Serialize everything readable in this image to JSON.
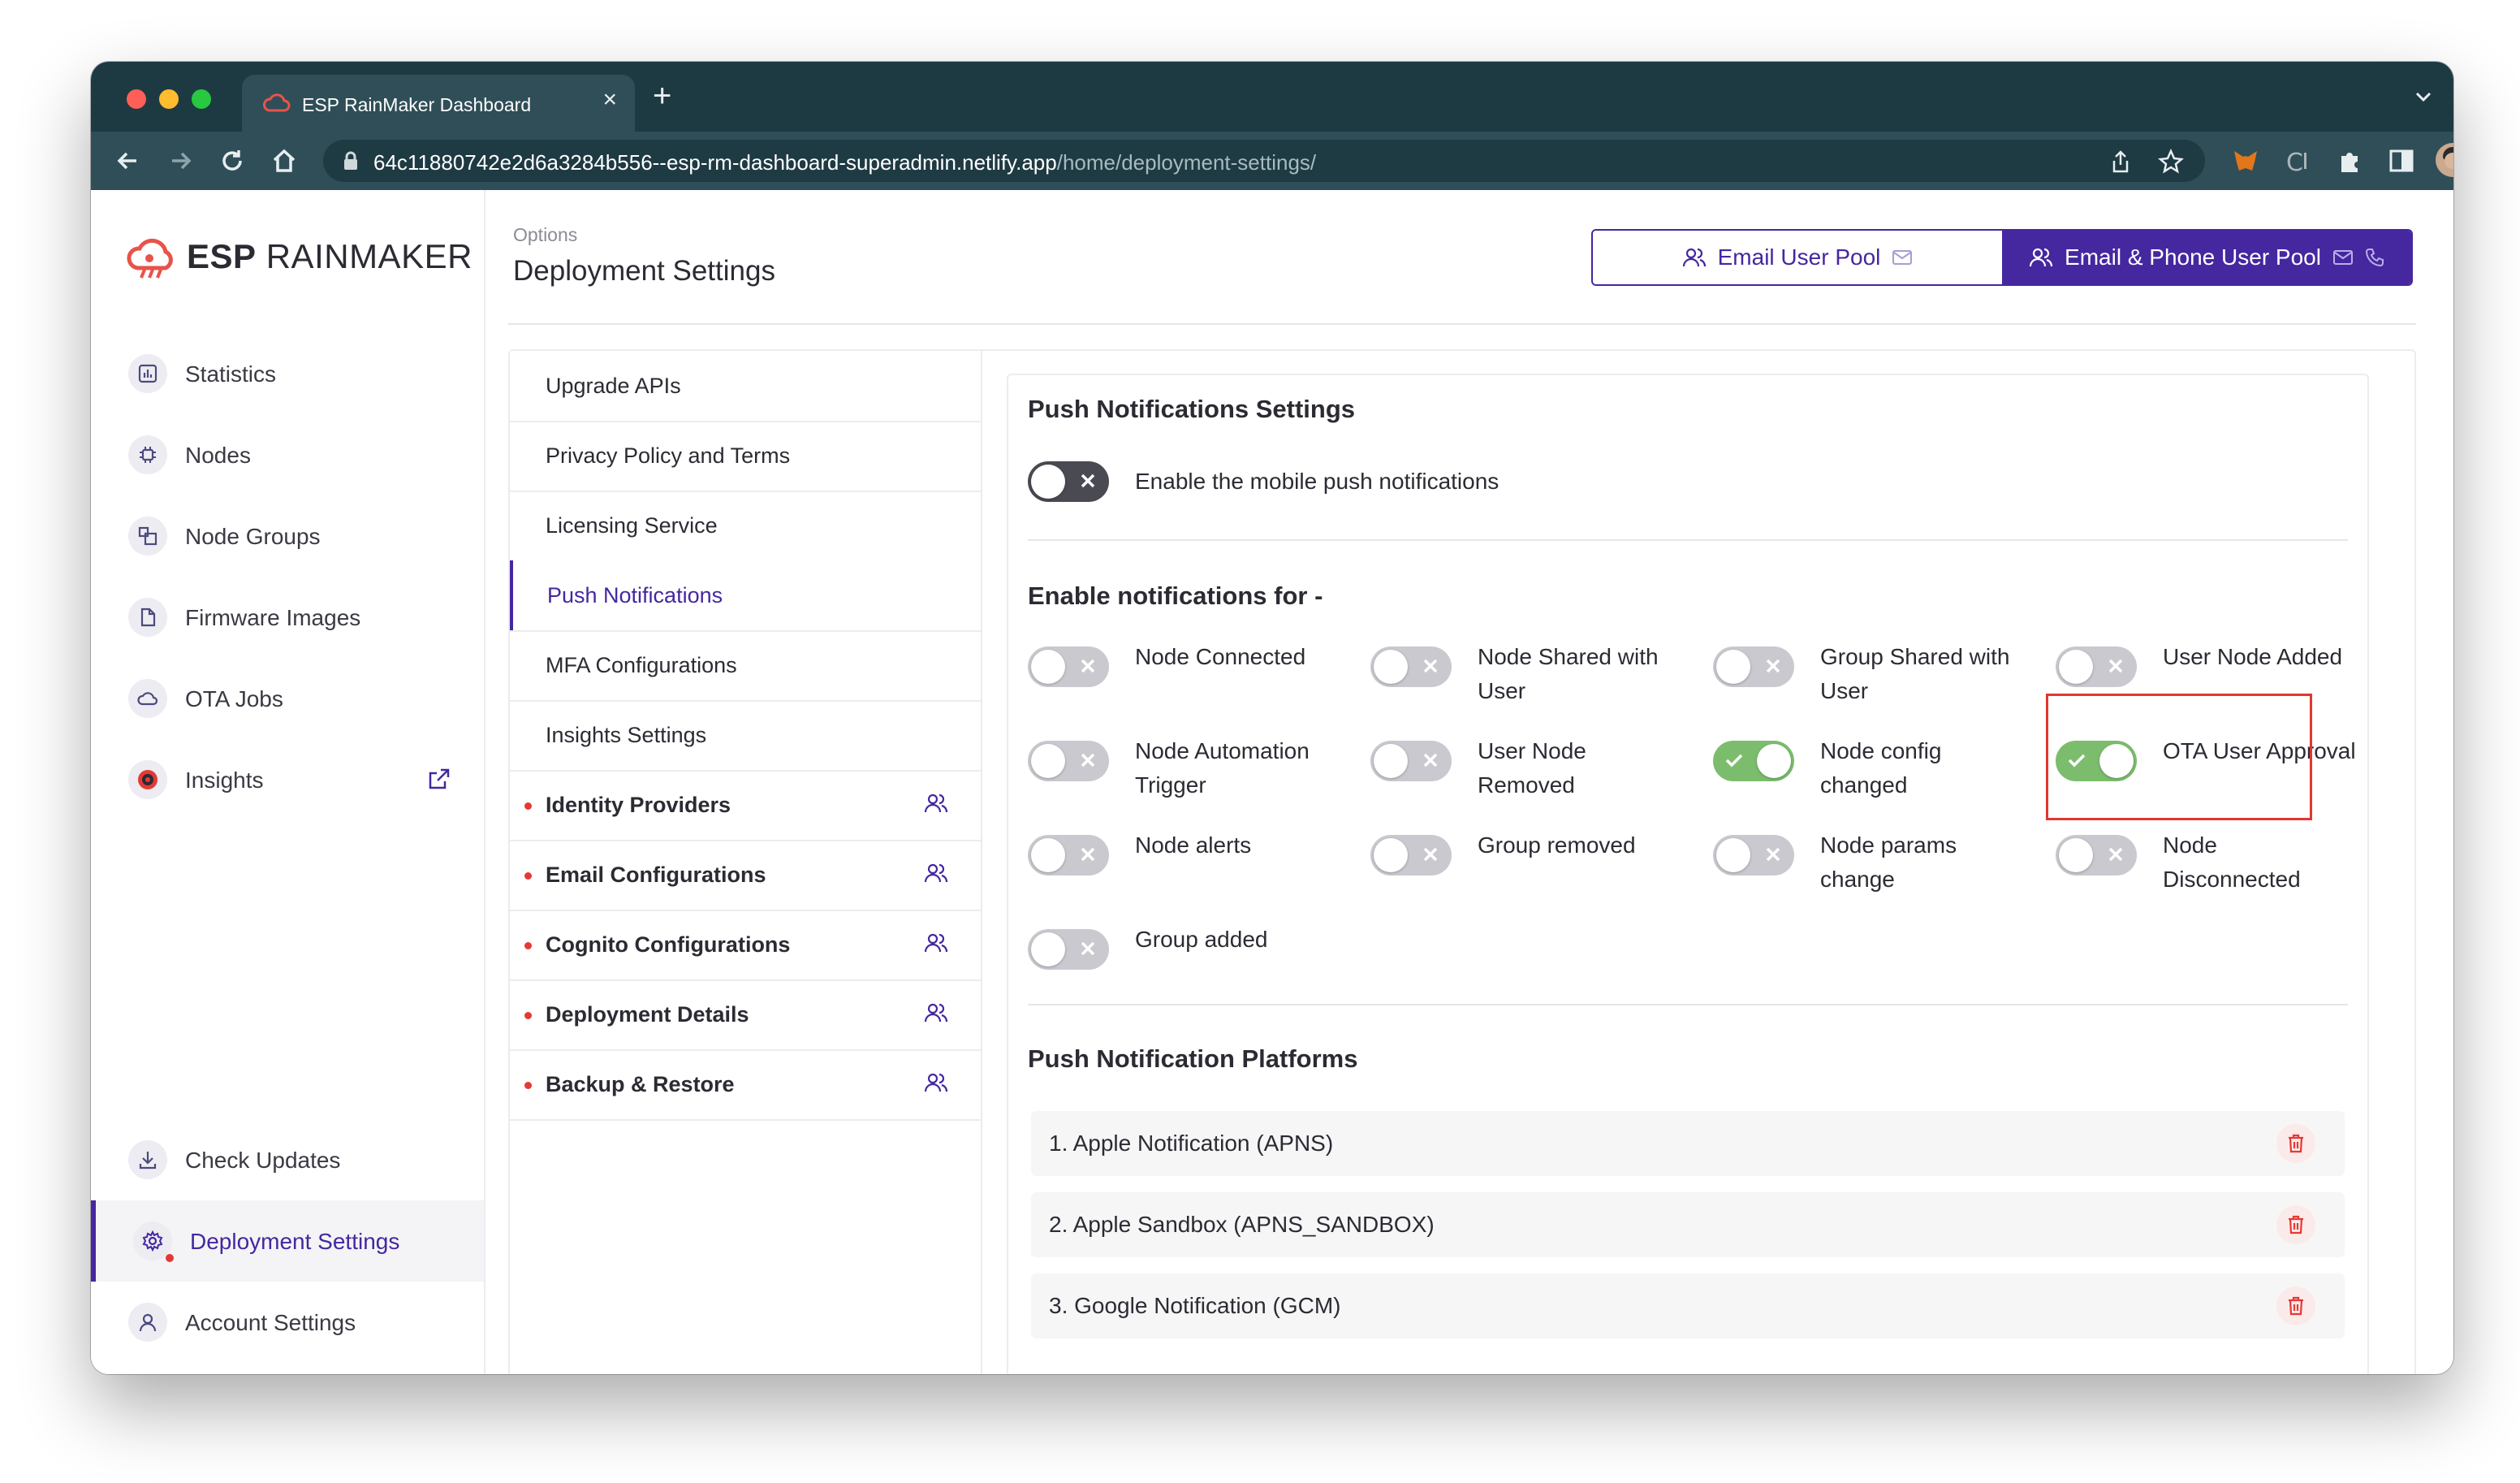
{
  "browser": {
    "tab_title": "ESP RainMaker Dashboard",
    "url_host": "64c11880742e2d6a3284b556--esp-rm-dashboard-superadmin.netlify.app",
    "url_path": "/home/deployment-settings/"
  },
  "app": {
    "logo_bold": "ESP",
    "logo_rest": "RAINMAKER",
    "accent_color": "#4527a0"
  },
  "sidebar": {
    "items": [
      {
        "label": "Statistics",
        "icon": "bar-chart-icon"
      },
      {
        "label": "Nodes",
        "icon": "chip-icon"
      },
      {
        "label": "Node Groups",
        "icon": "group-icon"
      },
      {
        "label": "Firmware Images",
        "icon": "file-icon"
      },
      {
        "label": "OTA Jobs",
        "icon": "cloud-icon"
      },
      {
        "label": "Insights",
        "icon": "insights-icon"
      }
    ],
    "bottom_items": [
      {
        "label": "Check Updates",
        "icon": "download-icon"
      },
      {
        "label": "Deployment Settings",
        "icon": "gear-icon"
      },
      {
        "label": "Account Settings",
        "icon": "user-icon"
      }
    ]
  },
  "header": {
    "breadcrumb": "Options",
    "title": "Deployment Settings",
    "pool_email": "Email User Pool",
    "pool_email_phone": "Email & Phone User Pool"
  },
  "menu": {
    "items": [
      {
        "label": "Upgrade APIs"
      },
      {
        "label": "Privacy Policy and Terms"
      },
      {
        "label": "Licensing Service"
      },
      {
        "label": "Push Notifications"
      },
      {
        "label": "MFA Configurations"
      },
      {
        "label": "Insights Settings"
      },
      {
        "label": "Identity Providers"
      },
      {
        "label": "Email Configurations"
      },
      {
        "label": "Cognito Configurations"
      },
      {
        "label": "Deployment Details"
      },
      {
        "label": "Backup & Restore"
      }
    ]
  },
  "push": {
    "settings_title": "Push Notifications Settings",
    "mobile_toggle_label": "Enable the mobile push notifications",
    "mobile_enabled": false,
    "enable_for_title": "Enable notifications for -",
    "toggles": [
      {
        "label": "Node Connected",
        "on": false
      },
      {
        "label": "Node Shared with User",
        "on": false
      },
      {
        "label": "Group Shared with User",
        "on": false
      },
      {
        "label": "User Node Added",
        "on": false
      },
      {
        "label": "Node Automation Trigger",
        "on": false
      },
      {
        "label": "User Node Removed",
        "on": false
      },
      {
        "label": "Node config changed",
        "on": true
      },
      {
        "label": "OTA User Approval",
        "on": true
      },
      {
        "label": "Node alerts",
        "on": false
      },
      {
        "label": "Group removed",
        "on": false
      },
      {
        "label": "Node params change",
        "on": false
      },
      {
        "label": "Node Disconnected",
        "on": false
      },
      {
        "label": "Group added",
        "on": false
      }
    ],
    "platforms_title": "Push Notification Platforms",
    "platforms": [
      {
        "label": "1. Apple Notification (APNS)"
      },
      {
        "label": "2. Apple Sandbox (APNS_SANDBOX)"
      },
      {
        "label": "3. Google Notification (GCM)"
      }
    ]
  }
}
